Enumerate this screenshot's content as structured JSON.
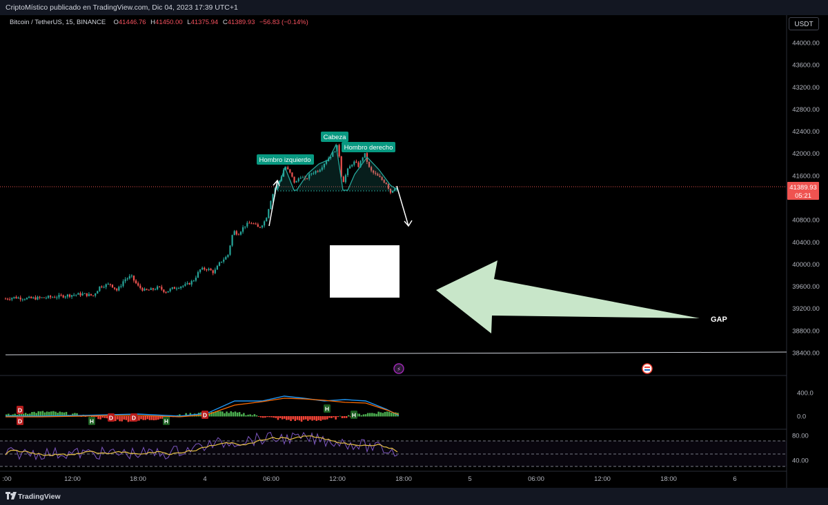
{
  "header": {
    "publisher_line": "CriptoMístico publicado en TradingView.com, Dic 04, 2023 17:39 UTC+1"
  },
  "legend": {
    "symbol": "Bitcoin / TetherUS, 15, BINANCE",
    "open_label": "O",
    "open": "41446.76",
    "high_label": "H",
    "high": "41450.00",
    "low_label": "L",
    "low": "41375.94",
    "close_label": "C",
    "close": "41389.93",
    "change": "−56.83 (−0.14%)"
  },
  "currency_button": "USDT",
  "price_axis": {
    "ticks": [
      "44000.00",
      "43600.00",
      "43200.00",
      "42800.00",
      "42400.00",
      "42000.00",
      "41600.00",
      "40800.00",
      "40400.00",
      "40000.00",
      "39600.00",
      "39200.00",
      "38800.00",
      "38400.00"
    ]
  },
  "last_price": {
    "value": "41389.93",
    "countdown": "05:21"
  },
  "time_axis": {
    "ticks": [
      ":00",
      "12:00",
      "18:00",
      "4",
      "06:00",
      "12:00",
      "18:00",
      "5",
      "06:00",
      "12:00",
      "18:00",
      "6"
    ]
  },
  "annotations": {
    "left_shoulder": "Hombro izquierdo",
    "head": "Cabeza",
    "right_shoulder": "Hombro derecho",
    "gap": "GAP"
  },
  "indicator1": {
    "ticks": [
      "400.0",
      "0.0"
    ],
    "markers": [
      "D",
      "D",
      "H",
      "D",
      "D",
      "H",
      "D",
      "H",
      "H"
    ]
  },
  "indicator2": {
    "ticks": [
      "80.00",
      "40.00"
    ]
  },
  "footer": {
    "brand": "TradingView"
  },
  "colors": {
    "up": "#26a69a",
    "down": "#ef5350",
    "accent": "#089981",
    "rsi": "#7e57c2",
    "rsi_ma": "#e8c245",
    "macd": "#2196f3",
    "signal": "#ff6d00",
    "arrow": "#c8e6c9"
  },
  "chart_data": {
    "type": "candlestick",
    "symbol": "Bitcoin / TetherUS",
    "interval": "15",
    "ylim": [
      38200,
      44300
    ],
    "path": [
      [
        0,
        39360
      ],
      [
        20,
        39400
      ],
      [
        40,
        39380
      ],
      [
        60,
        39390
      ],
      [
        80,
        39410
      ],
      [
        100,
        39440
      ],
      [
        120,
        39460
      ],
      [
        135,
        39430
      ],
      [
        145,
        39600
      ],
      [
        160,
        39640
      ],
      [
        170,
        39520
      ],
      [
        180,
        39720
      ],
      [
        190,
        39780
      ],
      [
        200,
        39600
      ],
      [
        210,
        39520
      ],
      [
        220,
        39540
      ],
      [
        230,
        39580
      ],
      [
        240,
        39500
      ],
      [
        250,
        39560
      ],
      [
        260,
        39600
      ],
      [
        270,
        39620
      ],
      [
        280,
        39700
      ],
      [
        290,
        39900
      ],
      [
        300,
        39920
      ],
      [
        310,
        39850
      ],
      [
        320,
        40050
      ],
      [
        330,
        40150
      ],
      [
        338,
        40600
      ],
      [
        345,
        40550
      ],
      [
        355,
        40700
      ],
      [
        365,
        40750
      ],
      [
        375,
        40650
      ],
      [
        385,
        40800
      ],
      [
        392,
        41150
      ],
      [
        400,
        41420
      ],
      [
        406,
        41530
      ],
      [
        413,
        41770
      ],
      [
        420,
        41650
      ],
      [
        428,
        41450
      ],
      [
        435,
        41600
      ],
      [
        442,
        41520
      ],
      [
        452,
        41650
      ],
      [
        462,
        41700
      ],
      [
        472,
        41860
      ],
      [
        482,
        42000
      ],
      [
        490,
        42150
      ],
      [
        496,
        41450
      ],
      [
        504,
        41700
      ],
      [
        512,
        41850
      ],
      [
        520,
        41770
      ],
      [
        528,
        42010
      ],
      [
        536,
        41700
      ],
      [
        544,
        41620
      ],
      [
        552,
        41540
      ],
      [
        560,
        41460
      ],
      [
        566,
        41300
      ],
      [
        572,
        41390
      ],
      [
        578,
        41390
      ]
    ]
  }
}
